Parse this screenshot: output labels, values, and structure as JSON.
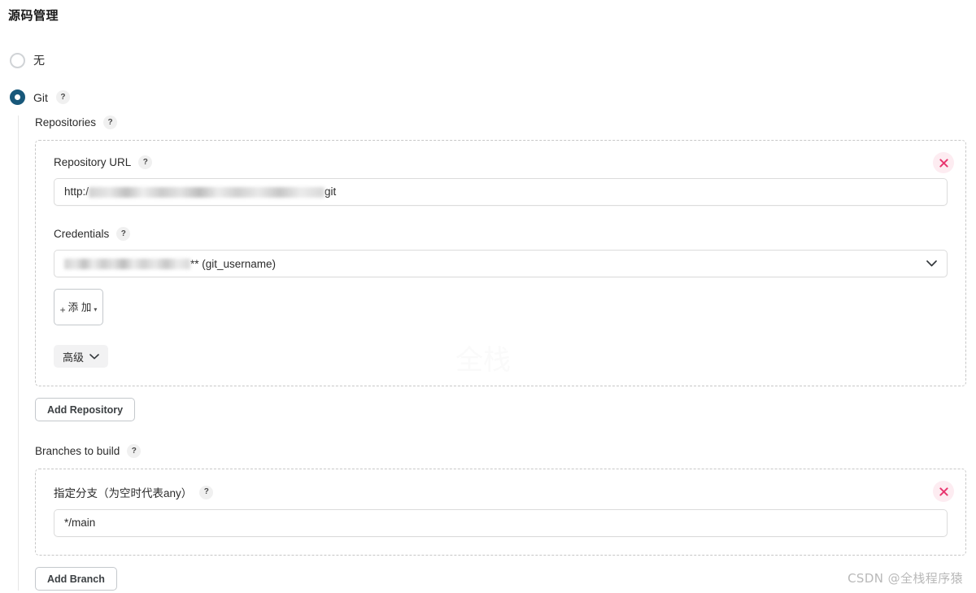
{
  "page": {
    "title": "源码管理",
    "watermark": "CSDN @全栈程序猿",
    "ghost_watermark": "全栈"
  },
  "scm": {
    "options": [
      {
        "label": "无",
        "selected": false,
        "has_help": false
      },
      {
        "label": "Git",
        "selected": true,
        "has_help": true
      }
    ]
  },
  "git": {
    "repositories_label": "Repositories",
    "repository": {
      "url_label": "Repository URL",
      "url_value_prefix": "http:/",
      "url_value_suffix": "git",
      "credentials_label": "Credentials",
      "credentials_value_suffix": "** (git_username)",
      "add_credentials_label_line1": "添",
      "add_credentials_label_line2": "加",
      "add_credentials_plus": "+",
      "advanced_label": "高级"
    },
    "add_repository_label": "Add Repository",
    "branches_label": "Branches to build",
    "branch": {
      "specifier_label": "指定分支（为空时代表any）",
      "specifier_value": "*/main"
    },
    "add_branch_label": "Add Branch"
  },
  "icons": {
    "help": "?",
    "chevron_down": "⌄",
    "caret_down": "▾"
  },
  "colors": {
    "radio_selected": "#18587a",
    "delete_bg": "#fdecf1",
    "delete_glyph": "#e8366f",
    "dashed_border": "#c7c7c7"
  }
}
